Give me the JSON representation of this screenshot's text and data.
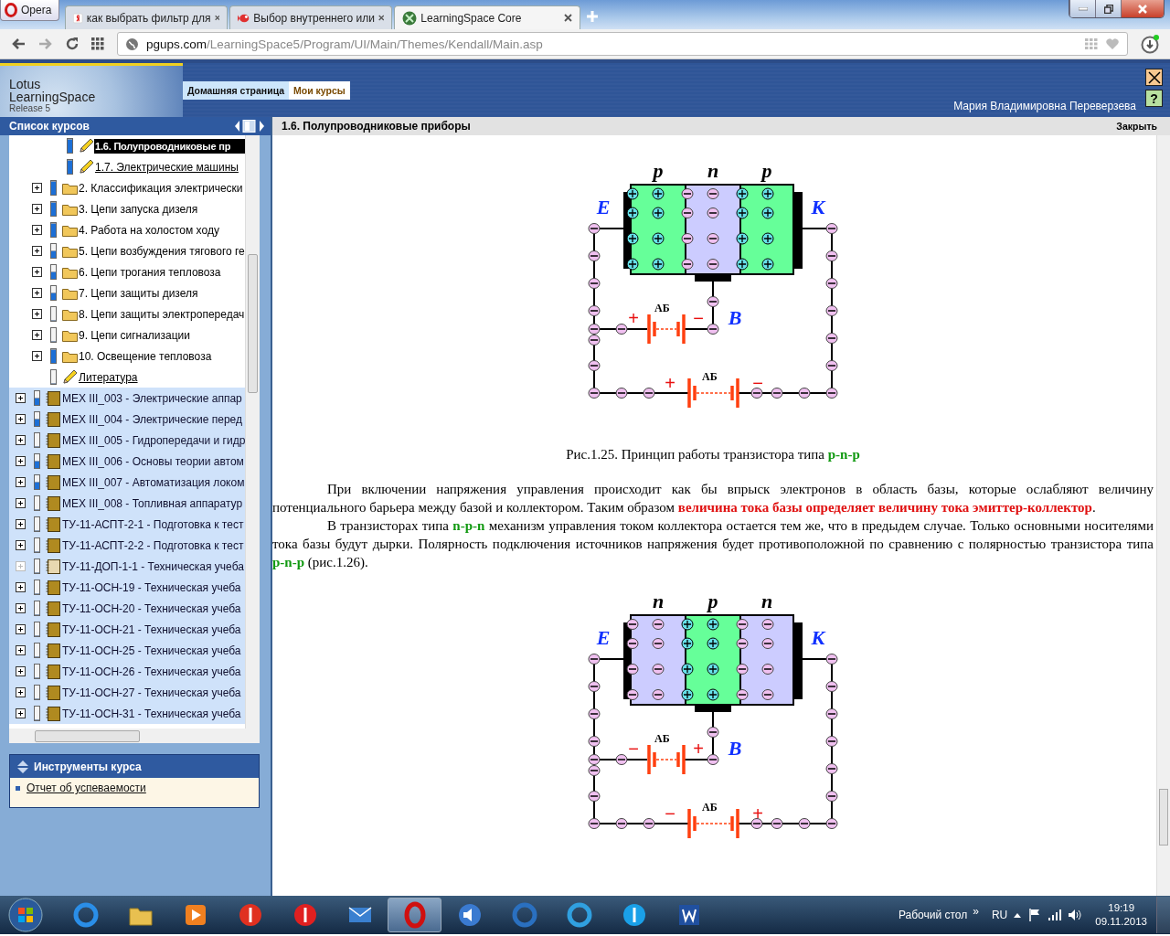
{
  "browser": {
    "menu_label": "Opera",
    "tabs": [
      {
        "title": "как выбрать фильтр для",
        "selected": false,
        "kind": "yandex"
      },
      {
        "title": "Выбор внутреннего или",
        "selected": false,
        "kind": "fish"
      },
      {
        "title": "LearningSpace Core",
        "selected": true,
        "kind": "ls"
      }
    ],
    "address": {
      "host": "pgups.com",
      "path": "/LearningSpace5/Program/UI/Main/Themes/Kendall/Main.asp"
    }
  },
  "header": {
    "logo": [
      "Lotus",
      "LearningSpace",
      "Release 5"
    ],
    "nav": [
      {
        "label": "Домашняя страница",
        "selected": true
      },
      {
        "label": "Мои курсы",
        "selected": false
      }
    ],
    "user": "Мария Владимировна Переверзева",
    "help_button": "?"
  },
  "sidebar": {
    "title": "Список курсов",
    "tree": [
      {
        "children": [
          {
            "children": [
              {
                "label": "1.6. Полупроводниковые пр",
                "kind": "lesson",
                "level": 1,
                "expandable": false,
                "selected": true
              },
              {
                "label": "1.7. Электрические машины",
                "kind": "lesson",
                "level": 1,
                "expandable": false,
                "selected": false
              }
            ]
          },
          {
            "label": "2. Классификация электрически",
            "kind": "folder",
            "level": 1,
            "expandable": true,
            "selected": false
          },
          {
            "label": "3. Цепи запуска дизеля",
            "kind": "folder",
            "level": 1,
            "expandable": true,
            "selected": false
          },
          {
            "label": "4. Работа на холостом ходу",
            "kind": "folder",
            "level": 1,
            "expandable": true,
            "selected": false
          },
          {
            "label": "5. Цепи возбуждения тягового ге",
            "kind": "folder",
            "level": 0.5,
            "expandable": true,
            "selected": false
          },
          {
            "label": "6. Цепи трогания тепловоза",
            "kind": "folder",
            "level": 0.5,
            "expandable": true,
            "selected": false
          },
          {
            "label": "7. Цепи защиты дизеля",
            "kind": "folder",
            "level": 0.5,
            "expandable": true,
            "selected": false
          },
          {
            "label": "8. Цепи защиты электропередач",
            "kind": "folder",
            "level": 0,
            "expandable": true,
            "selected": false
          },
          {
            "label": "9. Цепи сигнализации",
            "kind": "folder",
            "level": 0,
            "expandable": true,
            "selected": false
          },
          {
            "label": "10. Освещение тепловоза",
            "kind": "folder",
            "level": 1,
            "expandable": true,
            "selected": false
          },
          {
            "label": "Литература",
            "kind": "lesson",
            "level": 0,
            "expandable": false,
            "selected": false
          }
        ]
      },
      {
        "label": "МЕХ III_003 - Электрические аппар",
        "kind": "book",
        "level": 0.5,
        "expandable": true,
        "disabled": false,
        "selected": false
      },
      {
        "label": "МЕХ III_004 - Электрические перед",
        "kind": "book",
        "level": 0.5,
        "expandable": true,
        "disabled": false,
        "selected": false
      },
      {
        "label": "МЕХ III_005 - Гидропередачи и гидр",
        "kind": "book",
        "level": 0,
        "expandable": true,
        "disabled": false,
        "selected": false
      },
      {
        "label": "МЕХ III_006 - Основы теории автом",
        "kind": "book",
        "level": 0.5,
        "expandable": true,
        "disabled": false,
        "selected": false
      },
      {
        "label": "МЕХ III_007 - Автоматизация локом",
        "kind": "book",
        "level": 0.5,
        "expandable": true,
        "disabled": false,
        "selected": false
      },
      {
        "label": "МЕХ III_008 - Топливная аппаратур",
        "kind": "book",
        "level": 0,
        "expandable": true,
        "disabled": false,
        "selected": false
      },
      {
        "label": "ТУ-11-АСПТ-2-1 - Подготовка к тест",
        "kind": "book",
        "level": 0,
        "expandable": true,
        "disabled": false,
        "selected": false
      },
      {
        "label": "ТУ-11-АСПТ-2-2 - Подготовка к тест",
        "kind": "book",
        "level": 0,
        "expandable": true,
        "disabled": false,
        "selected": false
      },
      {
        "label": "ТУ-11-ДОП-1-1 - Техническая учеба",
        "kind": "book",
        "level": 0,
        "expandable": true,
        "disabled": true,
        "selected": false
      },
      {
        "label": "ТУ-11-ОСН-19 - Техническая учеба",
        "kind": "book",
        "level": 0,
        "expandable": true,
        "disabled": false,
        "selected": false
      },
      {
        "label": "ТУ-11-ОСН-20 - Техническая учеба",
        "kind": "book",
        "level": 0,
        "expandable": true,
        "disabled": false,
        "selected": false
      },
      {
        "label": "ТУ-11-ОСН-21 - Техническая учеба",
        "kind": "book",
        "level": 0,
        "expandable": true,
        "disabled": false,
        "selected": false
      },
      {
        "label": "ТУ-11-ОСН-25 - Техническая учеба",
        "kind": "book",
        "level": 0,
        "expandable": true,
        "disabled": false,
        "selected": false
      },
      {
        "label": "ТУ-11-ОСН-26 - Техническая учеба",
        "kind": "book",
        "level": 0,
        "expandable": true,
        "disabled": false,
        "selected": false
      },
      {
        "label": "ТУ-11-ОСН-27 - Техническая учеба",
        "kind": "book",
        "level": 0,
        "expandable": true,
        "disabled": false,
        "selected": false
      },
      {
        "label": "ТУ-11-ОСН-31 - Техническая учеба",
        "kind": "book",
        "level": 0,
        "expandable": true,
        "disabled": false,
        "selected": false
      }
    ],
    "tools": {
      "title": "Инструменты курса",
      "links": [
        "Отчет об успеваемости"
      ]
    }
  },
  "content": {
    "title": "1.6. Полупроводниковые приборы",
    "close": "Закрыть",
    "blocks": [
      {
        "kind": "diagram",
        "layers": [
          {
            "label": "p",
            "kind": "acceptor"
          },
          {
            "label": "n",
            "kind": "donor"
          },
          {
            "label": "p",
            "kind": "acceptor"
          }
        ],
        "terminals": [
          "Е",
          "К",
          "В"
        ],
        "batteries": [
          {
            "label": "АБ",
            "signs": [
              "+",
              "−"
            ]
          },
          {
            "label": "АБ",
            "signs": [
              "+",
              "−"
            ]
          }
        ]
      },
      {
        "kind": "caption",
        "color": "#119911",
        "text": "Рис.1.25. Принцип работы транзистора типа **p-n-p**"
      },
      {
        "kind": "paragraph",
        "color": "#e01010",
        "text": "При включении напряжения управления происходит как бы впрыск электронов в область базы, которые ослабляют величину потенциального барьера между базой и коллектором. Таким образом **величина тока базы определяет величину тока эмиттер-коллектор**."
      },
      {
        "kind": "paragraph",
        "color": "#119911",
        "text": "В транзисторах типа **n-p-n** механизм управления током коллектора остается тем же, что в предыдем случае. Только основными носителями тока базы будут дырки. Полярность подключения источников напряжения будет противоположной по сравнению с полярностью транзистора типа **p-n-p** (рис.1.26)."
      },
      {
        "kind": "diagram",
        "layers": [
          {
            "label": "n",
            "kind": "donor"
          },
          {
            "label": "p",
            "kind": "acceptor"
          },
          {
            "label": "n",
            "kind": "donor"
          }
        ],
        "terminals": [
          "Е",
          "К",
          "В"
        ],
        "batteries": [
          {
            "label": "АБ",
            "signs": [
              "−",
              "+"
            ]
          },
          {
            "label": "АБ",
            "signs": [
              "−",
              "+"
            ]
          }
        ]
      }
    ]
  },
  "taskbar": {
    "apps": [
      {
        "kind": "ie",
        "selected": false
      },
      {
        "kind": "files",
        "selected": false
      },
      {
        "kind": "player",
        "selected": false
      },
      {
        "kind": "ybrowser",
        "selected": false
      },
      {
        "kind": "yandex",
        "selected": false
      },
      {
        "kind": "mail",
        "selected": false
      },
      {
        "kind": "opera",
        "selected": true
      },
      {
        "kind": "sound",
        "selected": false
      },
      {
        "kind": "at",
        "selected": false
      },
      {
        "kind": "bird",
        "selected": false
      },
      {
        "kind": "skype",
        "selected": false
      },
      {
        "kind": "word",
        "selected": false
      }
    ],
    "desktop": "Рабочий стол",
    "more": "»",
    "lang": "RU",
    "time": "19:19",
    "date": "09.11.2013"
  }
}
